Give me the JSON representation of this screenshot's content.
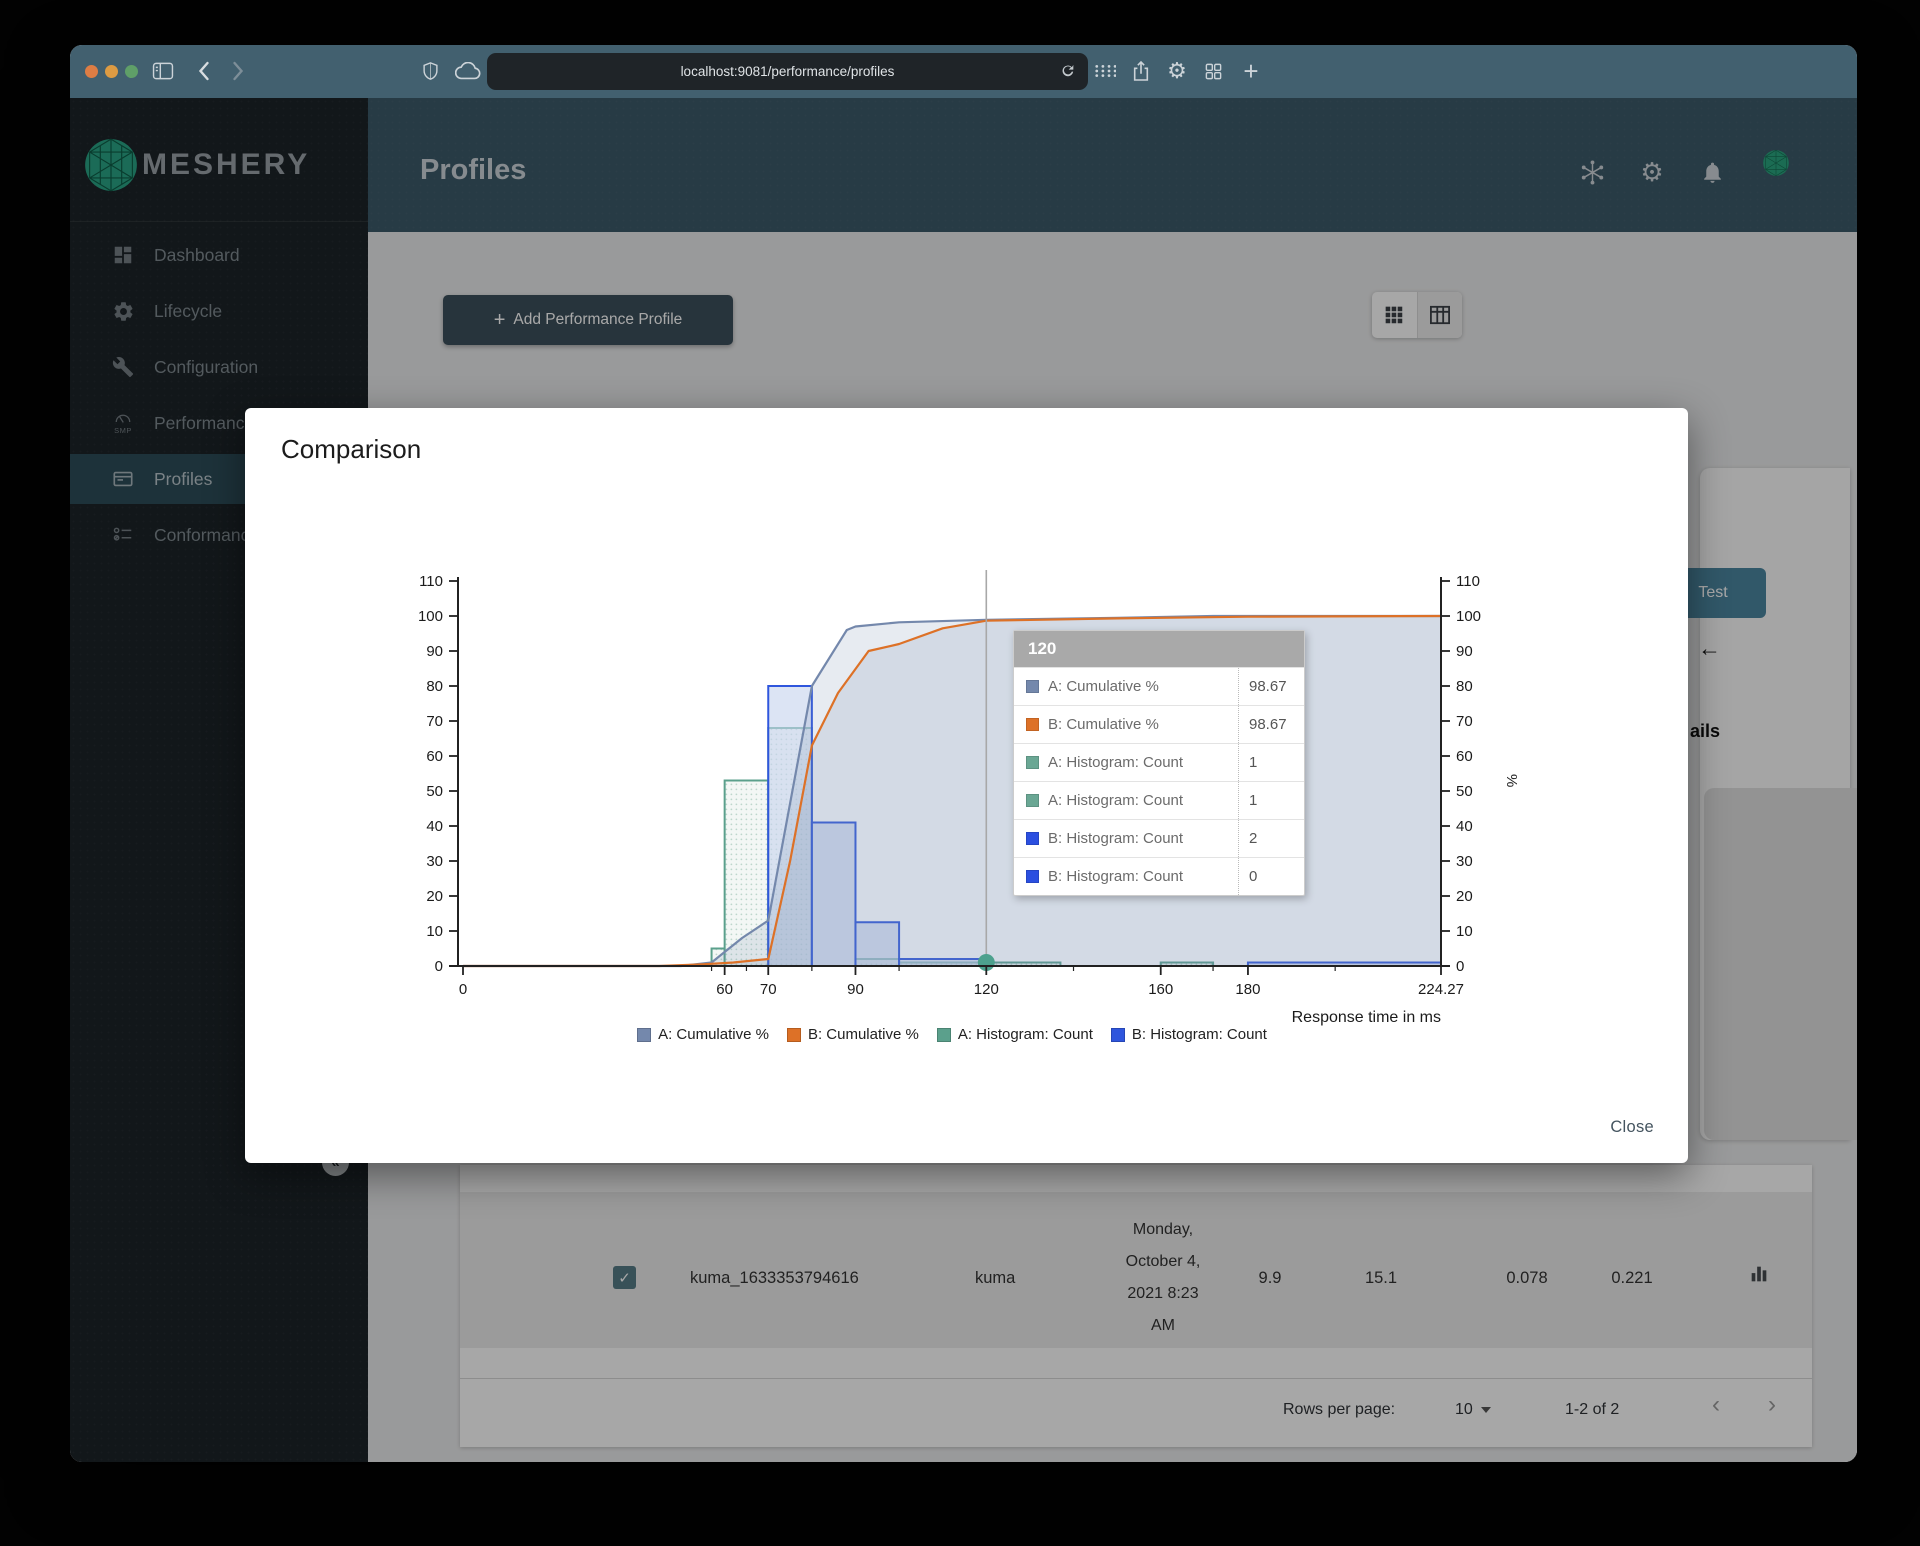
{
  "browser": {
    "url": "localhost:9081/performance/profiles",
    "icons": [
      "sidebar-toggle-icon",
      "back-icon",
      "forward-icon",
      "shield-icon",
      "cloud-icon",
      "refresh-icon",
      "tab-grid-icon",
      "share-icon",
      "settings-icon",
      "windows-icon",
      "new-tab-icon"
    ]
  },
  "header": {
    "brand": "MESHERY",
    "title": "Profiles",
    "icons": [
      "mesh-sync-icon",
      "gear-icon",
      "bell-icon",
      "avatar"
    ]
  },
  "sidebar": {
    "items": [
      {
        "label": "Dashboard",
        "icon": "dashboard-icon",
        "active": false,
        "caption": ""
      },
      {
        "label": "Lifecycle",
        "icon": "lifecycle-gear-icon",
        "active": false,
        "caption": ""
      },
      {
        "label": "Configuration",
        "icon": "configuration-wrench-icon",
        "active": false,
        "caption": ""
      },
      {
        "label": "Performance",
        "icon": "performance-speedometer-icon",
        "active": false,
        "caption": "SMP"
      },
      {
        "label": "Profiles",
        "icon": "profiles-card-icon",
        "active": true,
        "caption": ""
      },
      {
        "label": "Conformance",
        "icon": "conformance-checklist-icon",
        "active": false,
        "caption": ""
      }
    ],
    "help_glyph": "?",
    "collapse_glyph": "«"
  },
  "content": {
    "add_profile_label": "Add Performance Profile",
    "plus_glyph": "+",
    "test_button": "Test",
    "back_arrow_glyph": "←",
    "details_fragment": "ails"
  },
  "modal": {
    "title": "Comparison",
    "close_label": "Close"
  },
  "chart_data": {
    "type": "bar",
    "subtype": "histogram with cumulative % lines",
    "title": "",
    "xlabel": "Response time in ms",
    "ylabel": "%",
    "xlim": [
      0,
      224.27
    ],
    "ylim": [
      0,
      110
    ],
    "x_ticks": [
      0,
      60,
      70,
      90,
      120,
      160,
      180,
      224.27
    ],
    "x_minor_ticks": [
      57,
      65,
      80,
      100,
      140,
      172,
      200
    ],
    "y_ticks": [
      0,
      10,
      20,
      30,
      40,
      50,
      60,
      70,
      80,
      90,
      100,
      110
    ],
    "grid": false,
    "legend_position": "bottom",
    "series": [
      {
        "name": "A: Cumulative %",
        "kind": "line",
        "color": "#7488ac",
        "points": [
          [
            0,
            0
          ],
          [
            50,
            0
          ],
          [
            57,
            1
          ],
          [
            60,
            4
          ],
          [
            64,
            8
          ],
          [
            70,
            13
          ],
          [
            80,
            80
          ],
          [
            82,
            84
          ],
          [
            88,
            96
          ],
          [
            90,
            97
          ],
          [
            100,
            98.2
          ],
          [
            120,
            98.9
          ],
          [
            150,
            99.5
          ],
          [
            172,
            100
          ],
          [
            224.27,
            100
          ]
        ]
      },
      {
        "name": "B: Cumulative %",
        "kind": "line",
        "color": "#dd7127",
        "points": [
          [
            0,
            0
          ],
          [
            45,
            0
          ],
          [
            55,
            0.5
          ],
          [
            62,
            1
          ],
          [
            70,
            2
          ],
          [
            75,
            30
          ],
          [
            80,
            63
          ],
          [
            86,
            78
          ],
          [
            93,
            90
          ],
          [
            100,
            92
          ],
          [
            110,
            96.5
          ],
          [
            120,
            98.67
          ],
          [
            150,
            99.3
          ],
          [
            180,
            99.8
          ],
          [
            224.27,
            100
          ]
        ]
      },
      {
        "name": "A: Histogram: Count",
        "kind": "bar",
        "color": "#5ba08c",
        "bars": [
          [
            57,
            60,
            5
          ],
          [
            60,
            70,
            53
          ],
          [
            70,
            80,
            68
          ],
          [
            90,
            100,
            2
          ],
          [
            100,
            137,
            1
          ],
          [
            160,
            172,
            1
          ]
        ]
      },
      {
        "name": "B: Histogram: Count",
        "kind": "bar",
        "color": "#2f56dd",
        "bars": [
          [
            70,
            80,
            80
          ],
          [
            80,
            90,
            41
          ],
          [
            90,
            100,
            12.5
          ],
          [
            100,
            120,
            2
          ],
          [
            180,
            224.27,
            1
          ]
        ]
      }
    ],
    "hover": {
      "x_value": 120,
      "marker_color": "#4da18e"
    }
  },
  "tooltip": {
    "header": "120",
    "rows": [
      {
        "label": "A: Cumulative %",
        "value": "98.67",
        "color": "#7488ac"
      },
      {
        "label": "B: Cumulative %",
        "value": "98.67",
        "color": "#dd7127"
      },
      {
        "label": "A: Histogram: Count",
        "value": "1",
        "color": "#6aa794"
      },
      {
        "label": "A: Histogram: Count",
        "value": "1",
        "color": "#6aa794"
      },
      {
        "label": "B: Histogram: Count",
        "value": "2",
        "color": "#2b4fe0"
      },
      {
        "label": "B: Histogram: Count",
        "value": "0",
        "color": "#2b4fe0"
      }
    ]
  },
  "table": {
    "row": {
      "selected": true,
      "check_glyph": "✓",
      "name": "kuma_1633353794616",
      "mesh": "kuma",
      "date": "Monday, October 4, 2021 8:23 AM",
      "qps": "9.9",
      "duration": "15.1",
      "p50": "0.078",
      "p99": "0.221"
    }
  },
  "pagination": {
    "rows_per_page_label": "Rows per page:",
    "rows_per_page_value": "10",
    "range": "1-2 of 2",
    "prev_glyph": "‹",
    "next_glyph": "›"
  }
}
